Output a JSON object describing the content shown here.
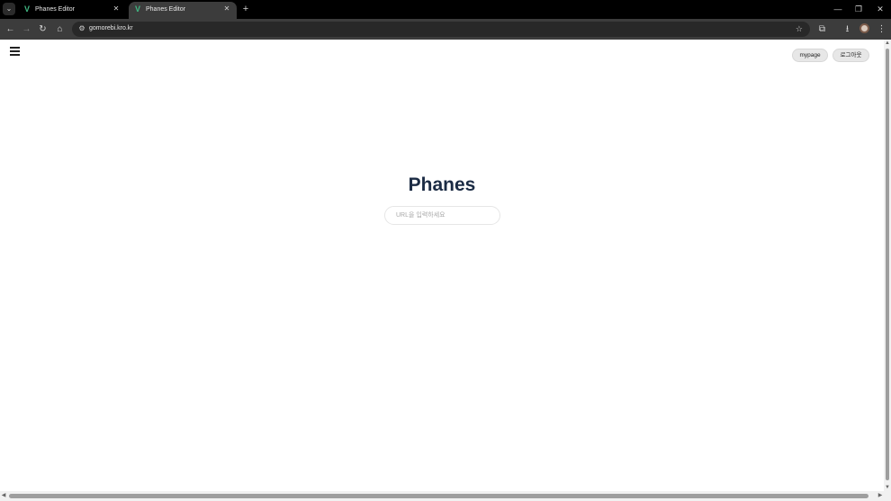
{
  "browser": {
    "tabs": [
      {
        "title": "Phanes Editor",
        "active": false
      },
      {
        "title": "Phanes Editor",
        "active": true
      }
    ],
    "address": "gomorebi.kro.kr",
    "icons": {
      "tab_search": "chevron-down",
      "favicon": "V",
      "close": "✕",
      "new_tab": "+",
      "minimize": "—",
      "restore": "❐",
      "window_close": "✕",
      "back": "←",
      "forward": "→",
      "reload": "↻",
      "home": "⌂",
      "site_info": "⚙",
      "bookmark": "☆",
      "extensions": "⧉",
      "downloads": "⭳",
      "menu": "⋮"
    }
  },
  "page": {
    "mypage_label": "mypage",
    "logout_label": "로그아웃",
    "brand": "Phanes",
    "url_placeholder": "URL을 입력하세요"
  },
  "colors": {
    "brand": "#1b2b44",
    "vue_green": "#41b883"
  }
}
